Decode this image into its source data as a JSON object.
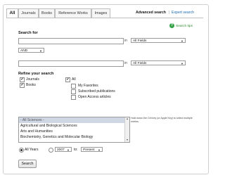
{
  "tabs": [
    {
      "label": "All",
      "active": true
    },
    {
      "label": "Journals"
    },
    {
      "label": "Books"
    },
    {
      "label": "Reference Works"
    },
    {
      "label": "Images"
    }
  ],
  "header": {
    "advanced_search": "Advanced search",
    "separator": "|",
    "expert_search": "Expert search"
  },
  "search_tips": {
    "label": "Search tips",
    "icon": "question-icon"
  },
  "search_for": {
    "label": "Search for",
    "in_label": "in",
    "field_1": "All Fields",
    "operator": "AND",
    "field_2": "All Fields"
  },
  "refine": {
    "label": "Refine your search",
    "journals": "Journals",
    "books": "Books",
    "all": "All",
    "my_favorites": "My Favorites",
    "subscribed": "Subscribed publications",
    "open_access": "Open Access articles"
  },
  "subjects": {
    "items": [
      "- All Sciences -",
      "Agricultural and Biological Sciences",
      "Arts and Humanities",
      "Biochemistry, Genetics and Molecular Biology"
    ],
    "hint": "Hold down the Ctrl key (or Apple Key) to select multiple entries."
  },
  "years": {
    "all_years": "All Years",
    "from": "2007",
    "to_label": "to:",
    "to": "Present"
  },
  "search_button": "Search",
  "colors": {
    "link": "#1a6bb3",
    "tips": "#2f8c2f",
    "selection": "#cfd7e5"
  }
}
